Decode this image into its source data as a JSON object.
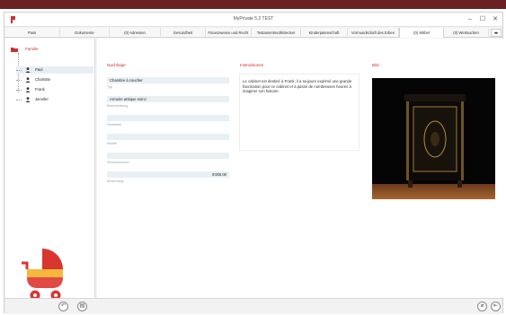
{
  "window": {
    "title": "MyPrivate 5.2 TEST"
  },
  "tabs": [
    {
      "label": "Pass"
    },
    {
      "label": "Dokumente"
    },
    {
      "label": "(0) Adressen"
    },
    {
      "label": "Gesundheit"
    },
    {
      "label": "Finanzwesen und Recht"
    },
    {
      "label": "Testamentsvollstrecker"
    },
    {
      "label": "Kinderpatenschaft"
    },
    {
      "label": "Vormundschaft des Erben"
    },
    {
      "label": "(0) Möbel"
    },
    {
      "label": "(0) Wertsachen"
    }
  ],
  "active_tab_index": 8,
  "sidebar": {
    "root_label": "Familie",
    "items": [
      {
        "label": "Paul"
      },
      {
        "label": "Charlotte"
      },
      {
        "label": "Frank"
      },
      {
        "label": "Jennifer"
      }
    ],
    "selected_index": 0
  },
  "nachfolge": {
    "title": "Nachfolge",
    "fields": [
      {
        "value": "Chambre à coucher",
        "label": "Typ"
      },
      {
        "value": "Armoire antique noirci",
        "label": "Beschreibung"
      },
      {
        "value": "",
        "label": "Hersteller"
      },
      {
        "value": "",
        "label": "Modell"
      },
      {
        "value": "",
        "label": "Seriennummer"
      },
      {
        "value": "6'000.00",
        "label": "Bewertung"
      }
    ]
  },
  "instruktionen": {
    "title": "Instruktionen",
    "text": "Le cabinet est destiné à Frank; il a toujours exprimé une grande fascination pour ce cabinet et a passé de nombreuses heures à imaginer son histoire."
  },
  "bild": {
    "title": "Bild"
  },
  "colors": {
    "accent": "#c9302c",
    "field_bg": "#e8f0f4",
    "top_stripe": "#6b2023"
  }
}
